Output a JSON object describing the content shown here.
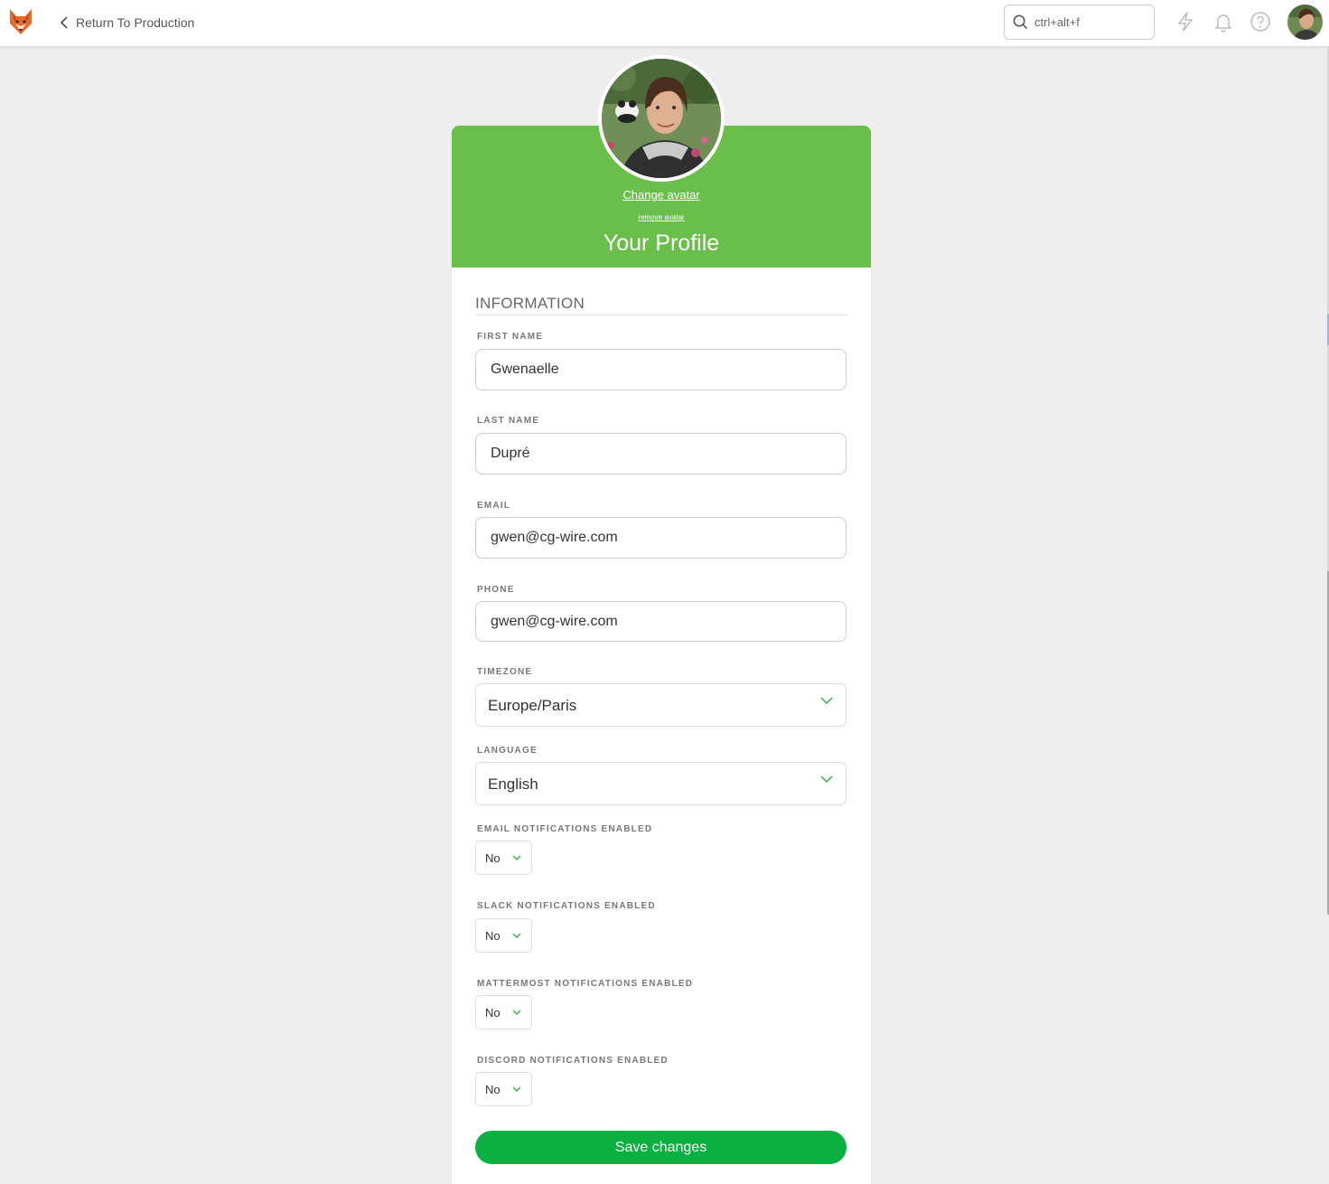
{
  "topbar": {
    "back_label": "Return To Production",
    "search_placeholder": "ctrl+alt+f"
  },
  "header": {
    "change_avatar": "Change avatar",
    "remove_avatar": "remove avatar",
    "title": "Your Profile"
  },
  "form": {
    "section_title": "INFORMATION",
    "first_name": {
      "label": "FIRST NAME",
      "value": "Gwenaelle"
    },
    "last_name": {
      "label": "LAST NAME",
      "value": "Dupré"
    },
    "email": {
      "label": "EMAIL",
      "value": "gwen@cg-wire.com"
    },
    "phone": {
      "label": "PHONE",
      "value": "gwen@cg-wire.com"
    },
    "timezone": {
      "label": "TIMEZONE",
      "value": "Europe/Paris"
    },
    "language": {
      "label": "LANGUAGE",
      "value": "English"
    },
    "email_notifications": {
      "label": "EMAIL NOTIFICATIONS ENABLED",
      "value": "No"
    },
    "slack_notifications": {
      "label": "SLACK NOTIFICATIONS ENABLED",
      "value": "No"
    },
    "mattermost_notifications": {
      "label": "MATTERMOST NOTIFICATIONS ENABLED",
      "value": "No"
    },
    "discord_notifications": {
      "label": "DISCORD NOTIFICATIONS ENABLED",
      "value": "No"
    },
    "save_label": "Save changes"
  },
  "colors": {
    "header_green": "#6abf4b",
    "save_green": "#0ab140",
    "chevron_green": "#2fb34a"
  },
  "icons": [
    "fox-logo-icon",
    "chevron-left-icon",
    "search-icon",
    "lightning-icon",
    "bell-icon",
    "help-circle-icon",
    "chevron-down-icon"
  ]
}
